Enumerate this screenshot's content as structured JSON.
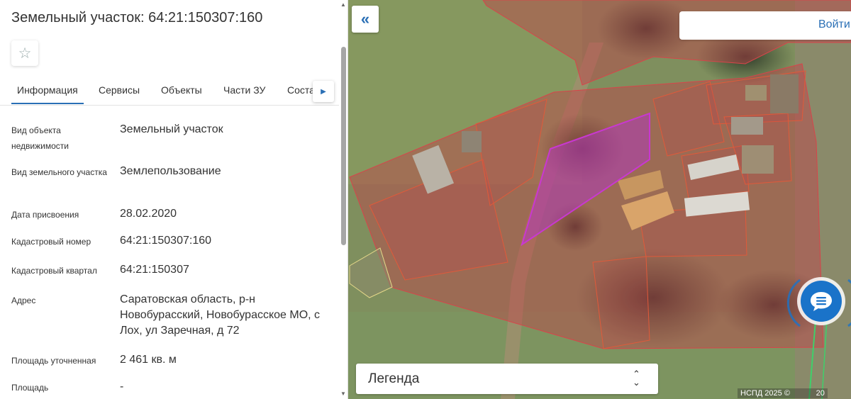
{
  "panel": {
    "title": "Земельный участок: 64:21:150307:160",
    "favorite_icon": "star-outline-icon",
    "tabs": [
      {
        "label": "Информация",
        "active": true
      },
      {
        "label": "Сервисы",
        "active": false
      },
      {
        "label": "Объекты",
        "active": false
      },
      {
        "label": "Части ЗУ",
        "active": false
      },
      {
        "label": "Соста",
        "active": false
      }
    ],
    "tab_next_icon": "chevron-right-icon",
    "fields": [
      {
        "label": "Вид объекта недвижимости",
        "value": "Земельный участок"
      },
      {
        "label": "Вид земельного участка",
        "value": "Землепользование"
      },
      {
        "label": "Дата присвоения",
        "value": "28.02.2020"
      },
      {
        "label": "Кадастровый номер",
        "value": "64:21:150307:160"
      },
      {
        "label": "Кадастровый квартал",
        "value": "64:21:150307"
      },
      {
        "label": "Адрес",
        "value": "Саратовская область, р-н Новобурасский, Новобурасское МО, с Лох, ул Заречная, д 72"
      },
      {
        "label": "Площадь уточненная",
        "value": "2 461 кв. м"
      },
      {
        "label": "Площадь",
        "value": "-"
      }
    ]
  },
  "map": {
    "collapse_icon": "double-chevron-left-icon",
    "login_label": "Войти",
    "legend_label": "Легенда",
    "legend_toggle_icon": "chevron-up-down-icon",
    "chat_icon": "chat-bubble-icon",
    "copyright": "НСПД 2025 ©",
    "scale_fragment": "20",
    "accent": "#2a6fb5",
    "parcel_fill": "#c0404a",
    "selected_parcel_color": "#b03ab8"
  }
}
